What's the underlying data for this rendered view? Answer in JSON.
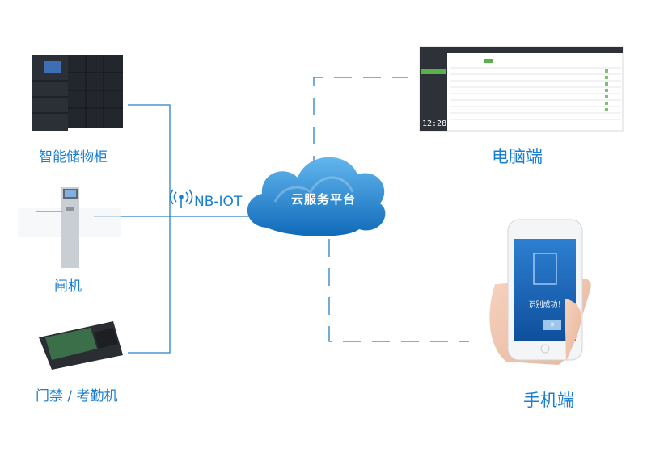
{
  "cloud": {
    "label": "云服务平台"
  },
  "protocol": {
    "label": "NB-IOT"
  },
  "devices": [
    {
      "label": "智能储物柜"
    },
    {
      "label": "闸机"
    },
    {
      "label": "门禁 / 考勤机"
    }
  ],
  "terminals": [
    {
      "label": "电脑端"
    },
    {
      "label": "手机端"
    }
  ],
  "screen": {
    "clock": "12:28:24"
  },
  "phone": {
    "status": "识别成功！",
    "button": "关"
  },
  "colors": {
    "accent": "#1a7fd0",
    "line": "#2a7fc4",
    "cloud_light": "#5aaee8",
    "cloud_dark": "#1574c2"
  }
}
